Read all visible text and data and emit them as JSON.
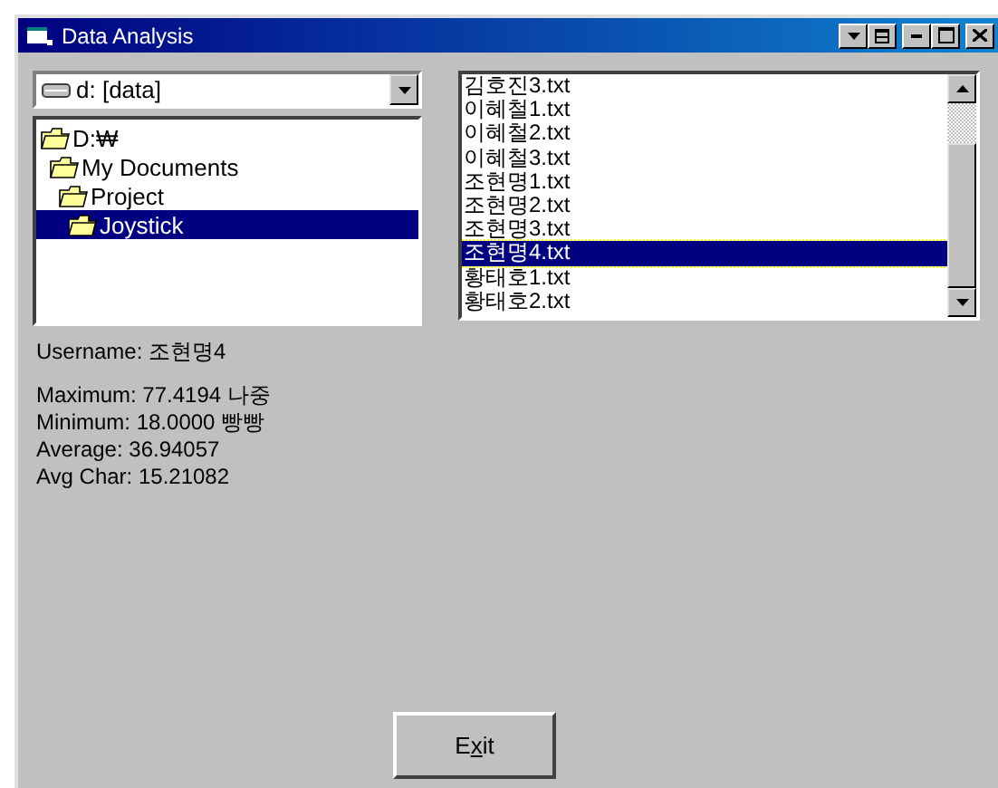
{
  "window": {
    "title": "Data Analysis"
  },
  "drive": {
    "value": "d: [data]"
  },
  "folders": [
    {
      "label": "D:₩",
      "selected": false,
      "children": [
        {
          "label": "My Documents",
          "selected": false,
          "children": [
            {
              "label": "Project",
              "selected": false,
              "children": [
                {
                  "label": "Joystick",
                  "selected": true
                }
              ]
            }
          ]
        }
      ]
    }
  ],
  "files": [
    {
      "label": "김호진3.txt",
      "selected": false
    },
    {
      "label": "이혜철1.txt",
      "selected": false
    },
    {
      "label": "이혜철2.txt",
      "selected": false
    },
    {
      "label": "이혜철3.txt",
      "selected": false
    },
    {
      "label": "조현명1.txt",
      "selected": false
    },
    {
      "label": "조현명2.txt",
      "selected": false
    },
    {
      "label": "조현명3.txt",
      "selected": false
    },
    {
      "label": "조현명4.txt",
      "selected": true
    },
    {
      "label": "황태호1.txt",
      "selected": false
    },
    {
      "label": "황태호2.txt",
      "selected": false
    }
  ],
  "username": "Username: 조현명4",
  "stats": [
    "Maximum: 77.4194 나중",
    "Minimum: 18.0000 빵빵",
    "Average: 36.94057",
    "Avg Char: 15.21082"
  ],
  "exit_button": {
    "label_parts": [
      {
        "text": "E",
        "underlined": false
      },
      {
        "text": "x",
        "underlined": true
      },
      {
        "text": "it",
        "underlined": false
      }
    ]
  }
}
